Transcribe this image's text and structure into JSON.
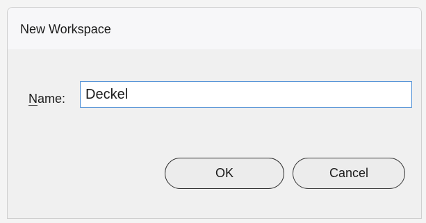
{
  "dialog": {
    "title": "New Workspace",
    "name_label_mnemonic": "N",
    "name_label_rest": "ame:",
    "name_value": "Deckel",
    "ok_label": "OK",
    "cancel_label": "Cancel"
  }
}
